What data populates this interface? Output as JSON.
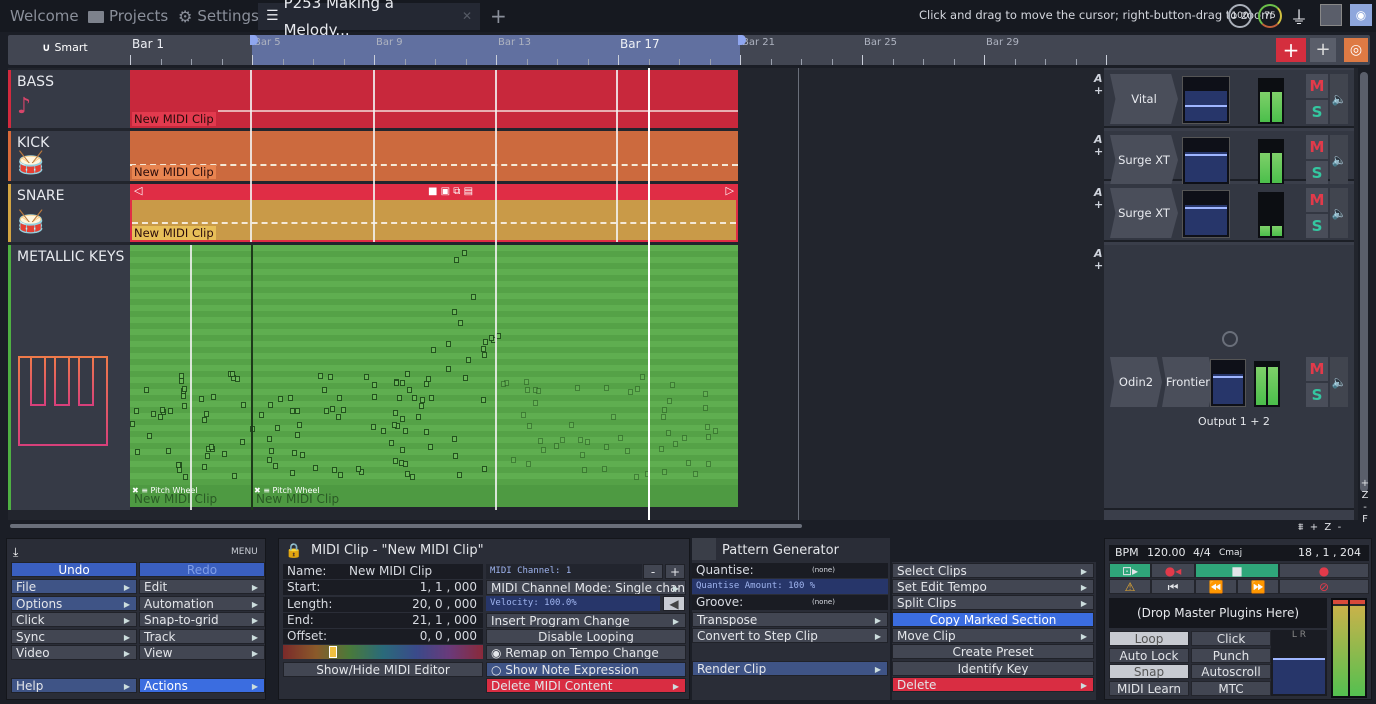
{
  "tabs": [
    {
      "label": "Welcome",
      "icon": "none"
    },
    {
      "label": "Projects",
      "icon": "folder-icon"
    },
    {
      "label": "Settings",
      "icon": "gear-icon"
    },
    {
      "label": "P253  Making a  Melody...",
      "icon": "edit-layout-icon",
      "active": true
    }
  ],
  "new_tab_label": "+",
  "hint": "Click and drag to move the cursor; right-button-drag to zoom",
  "gauges": {
    "cpu": "100",
    "load": "75"
  },
  "ruler": {
    "snap_label": "Smart",
    "bars": [
      {
        "label": "Bar 1",
        "major": true,
        "bar": 1
      },
      {
        "label": "Bar 5",
        "major": false,
        "bar": 5
      },
      {
        "label": "Bar 9",
        "major": false,
        "bar": 9
      },
      {
        "label": "Bar 13",
        "major": false,
        "bar": 13
      },
      {
        "label": "Bar 17",
        "major": true,
        "bar": 17
      },
      {
        "label": "Bar 21",
        "major": false,
        "bar": 21
      },
      {
        "label": "Bar 25",
        "major": false,
        "bar": 25
      },
      {
        "label": "Bar 29",
        "major": false,
        "bar": 29
      }
    ],
    "loop_start_bar": 5,
    "loop_end_bar": 21
  },
  "tracks": [
    {
      "name": "BASS",
      "color": "#d22a3e",
      "clip_color": "#c8283c",
      "clip_label": "New MIDI Clip",
      "label_bg": "#e23a4e",
      "icon": "bass-instrument-icon",
      "plugins": [
        "Vital"
      ]
    },
    {
      "name": "KICK",
      "color": "#d96a3a",
      "clip_color": "#cc6a3e",
      "clip_label": "New MIDI Clip",
      "label_bg": "#e88450",
      "icon": "drum-kit-icon",
      "plugins": [
        "Surge XT"
      ]
    },
    {
      "name": "SNARE",
      "color": "#d3a542",
      "clip_color": "#c99a48",
      "clip_label": "New MIDI Clip",
      "label_bg": "#e7be58",
      "icon": "drum-kit-icon",
      "plugins": [
        "Surge XT"
      ]
    },
    {
      "name": "METALLIC KEYS",
      "color": "#4fb043",
      "clip_color": "#5aa94c",
      "clip_label": "New MIDI Clip",
      "icon": "piano-keys-icon",
      "plugins": [
        "Odin2",
        "Frontier"
      ],
      "output": "Output 1 + 2",
      "automation_label": "Pitch Wheel"
    }
  ],
  "mixer": {
    "mute": "M",
    "solo": "S",
    "auto": "A",
    "add": "+"
  },
  "zoom_controls": [
    "+",
    "Z",
    "-",
    "F"
  ],
  "menu": {
    "header": "MENU",
    "undo": "Undo",
    "redo": "Redo",
    "items": [
      [
        "File",
        "Edit"
      ],
      [
        "Options",
        "Automation"
      ],
      [
        "Click",
        "Snap-to-grid"
      ],
      [
        "Sync",
        "Track"
      ],
      [
        "Video",
        "View"
      ]
    ],
    "help": "Help",
    "actions": "Actions"
  },
  "clip_panel": {
    "title": "MIDI Clip - \"New MIDI Clip\"",
    "fields": [
      {
        "label": "Name:",
        "value": "New MIDI Clip"
      },
      {
        "label": "Start:",
        "value": "1, 1 , 000"
      },
      {
        "label": "Length:",
        "value": "20, 0 , 000"
      },
      {
        "label": "End:",
        "value": "21, 1 , 000"
      },
      {
        "label": "Offset:",
        "value": "0, 0 , 000"
      }
    ],
    "show_hide_editor": "Show/Hide MIDI Editor",
    "midi_channel": "MIDI Channel: 1",
    "minus": "-",
    "plus": "+",
    "channel_mode": "MIDI Channel Mode: Single channel",
    "velocity": "Velocity: 100.0%",
    "insert_program_change": "Insert Program Change",
    "disable_looping": "Disable Looping",
    "remap_tempo": "Remap on Tempo Change",
    "show_note_expression": "Show Note Expression",
    "delete_midi_content": "Delete MIDI Content"
  },
  "pattern_panel": {
    "title": "Pattern Generator",
    "quantise_label": "Quantise:",
    "quantise_value": "(none)",
    "quantise_amount": "Quantise Amount: 100 %",
    "groove_label": "Groove:",
    "groove_value": "(none)",
    "transpose": "Transpose",
    "convert_step": "Convert to Step Clip",
    "render_clip": "Render Clip"
  },
  "clip_actions": {
    "select_clips": "Select Clips",
    "set_edit_tempo": "Set Edit Tempo",
    "split_clips": "Split Clips",
    "copy_marked_section": "Copy Marked Section",
    "move_clip": "Move Clip",
    "create_preset": "Create Preset",
    "identify_key": "Identify Key",
    "delete": "Delete"
  },
  "transport": {
    "bpm_label": "BPM",
    "bpm": "120.00",
    "time_sig": "4/4",
    "key": "Cmaj",
    "position": "18 , 1 , 204",
    "drop_plugins": "(Drop Master Plugins Here)",
    "toggles": [
      {
        "label": "Loop",
        "on": true
      },
      {
        "label": "Click",
        "on": false
      },
      {
        "label": "Auto Lock",
        "on": false
      },
      {
        "label": "Punch",
        "on": false
      },
      {
        "label": "Snap",
        "on": true
      },
      {
        "label": "Autoscroll",
        "on": false
      },
      {
        "label": "MIDI Learn",
        "on": false
      },
      {
        "label": "MTC",
        "on": false
      }
    ],
    "lr_label": "L  R"
  },
  "colors": {
    "accent_blue": "#3b6de0",
    "red": "#d92d42",
    "green": "#2fa67a"
  }
}
